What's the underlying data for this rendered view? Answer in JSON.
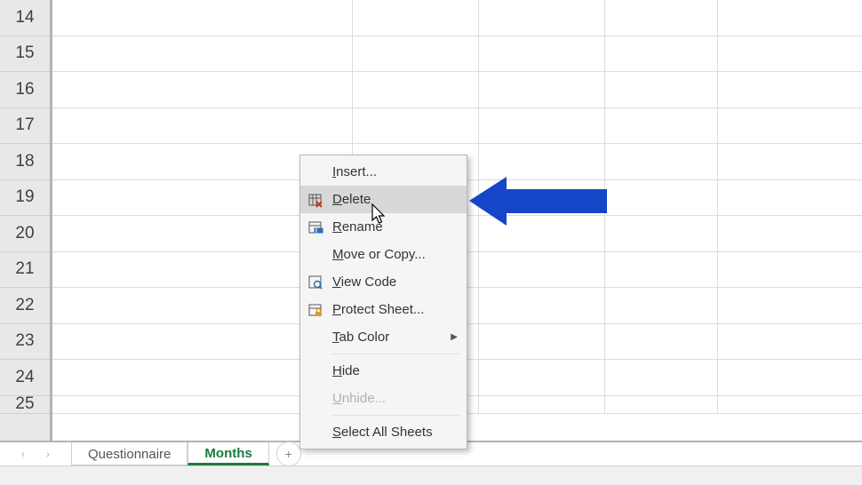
{
  "rows": [
    "14",
    "15",
    "16",
    "17",
    "18",
    "19",
    "20",
    "21",
    "22",
    "23",
    "24",
    "25"
  ],
  "tabs": {
    "nav_prev": "‹",
    "nav_next": "›",
    "tab1": "Questionnaire",
    "tab2": "Months",
    "add": "+"
  },
  "menu": {
    "insert": "Insert...",
    "delete": "Delete",
    "rename": "Rename",
    "move": "Move or Copy...",
    "viewcode": "View Code",
    "protect": "Protect Sheet...",
    "tabcolor": "Tab Color",
    "hide": "Hide",
    "unhide": "Unhide...",
    "selectall": "Select All Sheets"
  }
}
